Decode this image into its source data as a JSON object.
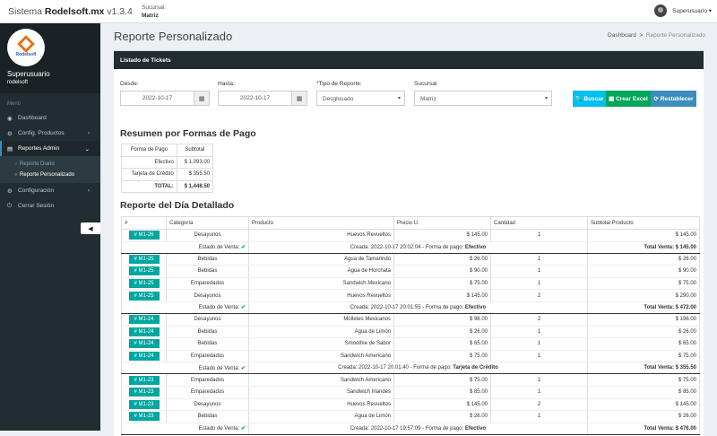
{
  "app": {
    "brand_pre": "Sistema ",
    "brand_name": "Rodelsoft.mx",
    "brand_ver": " v1.3.4",
    "sucursal_label": "Sucursal:",
    "sucursal_value": "Matriz",
    "user": "Superusuario ▾"
  },
  "sidebar": {
    "logo_text": "Rodelsoft",
    "user_name": "Superusuario",
    "user_sub": "rodelsoft",
    "menu_header": "Menú",
    "items": [
      {
        "icon": "◉",
        "label": "Dashboard"
      },
      {
        "icon": "⚙",
        "label": "Config. Productos"
      },
      {
        "icon": "▤",
        "label": "Reportes Admin"
      }
    ],
    "subitems": [
      {
        "label": "Reporte Diario"
      },
      {
        "label": "Reporte Personalizado"
      }
    ],
    "bottom": [
      {
        "icon": "⚙",
        "label": "Configuración"
      },
      {
        "icon": "⏻",
        "label": "Cerrar Sesión"
      }
    ],
    "toggle": "◀"
  },
  "page": {
    "title": "Reporte Personalizado",
    "bc_home": "Dashboard",
    "bc_current": "Reporte Personalizado",
    "box_title": "Listado de Tickets"
  },
  "filters": {
    "desde_label": "Desde:",
    "desde": "2022-10-17",
    "hasta_label": "Hasta:",
    "hasta": "2022-10-17",
    "tipo_label": "*Tipo de Reporte:",
    "tipo": "Desglosado",
    "sucursal_label": "Sucursal",
    "sucursal": "Matriz",
    "buscar": "🔍 Buscar",
    "excel": "▦ Crear Excel",
    "reset": "⟳ Restablecer",
    "colors": {
      "buscar": "#00c0ef",
      "excel": "#00a65a",
      "reset": "#3c8dbc"
    }
  },
  "summary": {
    "title": "Resumen por Formas de Pago",
    "headers": [
      "Forma de Pago",
      "Subtotal"
    ],
    "rows": [
      [
        "Efectivo",
        "$ 1,093.00"
      ],
      [
        "Tarjeta de Crédito",
        "$ 355.50"
      ]
    ],
    "total_label": "TOTAL:",
    "total": "$ 1,448.50"
  },
  "detail": {
    "title": "Reporte del Día Detallado",
    "headers": [
      "#",
      "Categoría",
      "Producto",
      "Precio U.",
      "Cantidad",
      "Subtotal Producto"
    ],
    "estado_label": "Estado de Venta:",
    "tickets": [
      {
        "id": "# M1-26",
        "items": [
          [
            "Desayunos",
            "Huevos Revueltos",
            "$ 145.00",
            "1",
            "$ 145.00"
          ]
        ],
        "creada": "Creada: 2022-10-17 20:02:04 - Forma de pago:",
        "pago": "Efectivo",
        "total": "Total Venta: $ 145.00"
      },
      {
        "id": "# M1-25",
        "items": [
          [
            "Bebidas",
            "Agua de Tamarindo",
            "$ 26.00",
            "1",
            "$ 26.00"
          ],
          [
            "Bebidas",
            "Agua de Horchata",
            "$ 90.00",
            "1",
            "$ 90.00"
          ],
          [
            "Emparedados",
            "Sandwich Mexicano",
            "$ 75.00",
            "1",
            "$ 75.00"
          ],
          [
            "Desayunos",
            "Huevos Revueltos",
            "$ 145.00",
            "2",
            "$ 290.00"
          ]
        ],
        "creada": "Creada: 2022-10-17 20:01:55 - Forma de pago:",
        "pago": "Efectivo",
        "total": "Total Venta: $ 472.00"
      },
      {
        "id": "# M1-24",
        "items": [
          [
            "Desayunos",
            "Molletes Mexicanos",
            "$ 98.00",
            "2",
            "$ 196.00"
          ],
          [
            "Bebidas",
            "Agua de Limón",
            "$ 26.00",
            "1",
            "$ 26.00"
          ],
          [
            "Bebidas",
            "Smoothie de Sabor",
            "$ 65.00",
            "1",
            "$ 65.00"
          ],
          [
            "Emparedados",
            "Sandwich Americano",
            "$ 75.00",
            "1",
            "$ 75.00"
          ]
        ],
        "creada": "Creada: 2022-10-17 20:01:40 - Forma de pago:",
        "pago": "Tarjeta de Crédito",
        "total": "Total Venta: $ 355.50"
      },
      {
        "id": "# M1-23",
        "items": [
          [
            "Emparedados",
            "Sandwich Americano",
            "$ 75.00",
            "1",
            "$ 75.00"
          ],
          [
            "Emparedados",
            "Sandwich Irlandés",
            "$ 85.00",
            "1",
            "$ 85.00"
          ],
          [
            "Desayunos",
            "Huevos Revueltos",
            "$ 145.00",
            "2",
            "$ 145.00"
          ],
          [
            "Bebidas",
            "Agua de Limón",
            "$ 26.00",
            "1",
            "$ 26.00"
          ]
        ],
        "creada": "Creada: 2022-10-17 19:57:09 - Forma de pago:",
        "pago": "Efectivo",
        "total": "Total Venta: $ 476.00"
      }
    ]
  }
}
